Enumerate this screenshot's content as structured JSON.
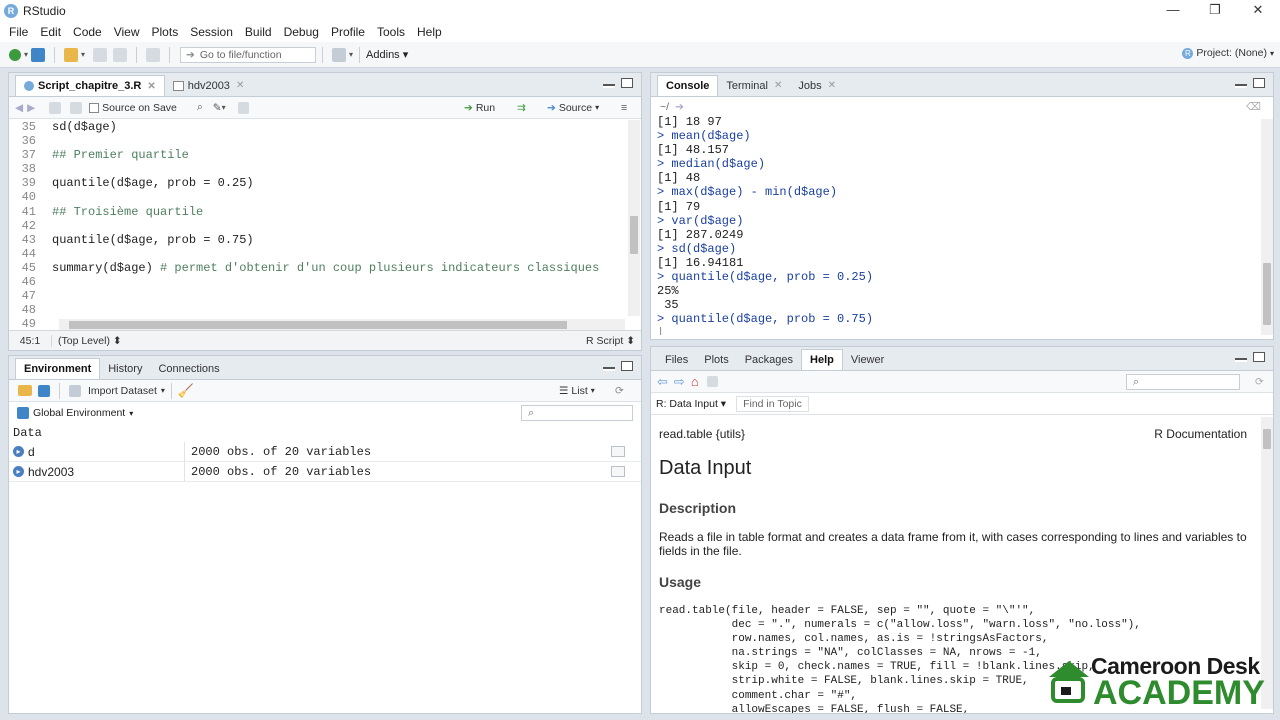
{
  "app": {
    "title": "RStudio",
    "logo_letter": "R"
  },
  "window_controls": {
    "minimize": "—",
    "maximize": "❐",
    "close": "✕"
  },
  "menu": [
    "File",
    "Edit",
    "Code",
    "View",
    "Plots",
    "Session",
    "Build",
    "Debug",
    "Profile",
    "Tools",
    "Help"
  ],
  "toolbar": {
    "goto_placeholder": "Go to file/function",
    "addins": "Addins",
    "project": "Project: (None)"
  },
  "editor": {
    "tabs": [
      {
        "label": "Script_chapitre_3.R",
        "active": true
      },
      {
        "label": "hdv2003",
        "active": false
      }
    ],
    "source_on_save": "Source on Save",
    "run": "Run",
    "source": "Source",
    "lines": [
      {
        "n": "35",
        "code": "sd(d$age)",
        "comment": ""
      },
      {
        "n": "36",
        "code": "",
        "comment": ""
      },
      {
        "n": "37",
        "code": "",
        "comment": "## Premier quartile"
      },
      {
        "n": "38",
        "code": "",
        "comment": ""
      },
      {
        "n": "39",
        "code": "quantile(d$age, prob = 0.25)",
        "comment": ""
      },
      {
        "n": "40",
        "code": "",
        "comment": ""
      },
      {
        "n": "41",
        "code": "",
        "comment": "## Troisième quartile"
      },
      {
        "n": "42",
        "code": "",
        "comment": ""
      },
      {
        "n": "43",
        "code": "quantile(d$age, prob = 0.75)",
        "comment": ""
      },
      {
        "n": "44",
        "code": "",
        "comment": ""
      },
      {
        "n": "45",
        "code": "summary(d$age) ",
        "comment": "# permet d'obtenir d'un coup plusieurs indicateurs classiques"
      },
      {
        "n": "46",
        "code": "",
        "comment": ""
      },
      {
        "n": "47",
        "code": "",
        "comment": ""
      },
      {
        "n": "48",
        "code": "",
        "comment": ""
      },
      {
        "n": "49",
        "code": "",
        "comment": ""
      }
    ],
    "status_pos": "45:1",
    "status_scope": "(Top Level)",
    "status_type": "R Script"
  },
  "console": {
    "tabs": [
      {
        "label": "Console",
        "active": true
      },
      {
        "label": "Terminal",
        "active": false
      },
      {
        "label": "Jobs",
        "active": false
      }
    ],
    "path": "~/",
    "lines": [
      {
        "kind": "out",
        "text": "[1] 18 97"
      },
      {
        "kind": "prompt",
        "text": "> mean(d$age)"
      },
      {
        "kind": "out",
        "text": "[1] 48.157"
      },
      {
        "kind": "prompt",
        "text": "> median(d$age)"
      },
      {
        "kind": "out",
        "text": "[1] 48"
      },
      {
        "kind": "prompt",
        "text": "> max(d$age) - min(d$age)"
      },
      {
        "kind": "out",
        "text": "[1] 79"
      },
      {
        "kind": "prompt",
        "text": "> var(d$age)"
      },
      {
        "kind": "out",
        "text": "[1] 287.0249"
      },
      {
        "kind": "prompt",
        "text": "> sd(d$age)"
      },
      {
        "kind": "out",
        "text": "[1] 16.94181"
      },
      {
        "kind": "prompt",
        "text": "> quantile(d$age, prob = 0.25)"
      },
      {
        "kind": "out",
        "text": "25% "
      },
      {
        "kind": "out",
        "text": " 35 "
      },
      {
        "kind": "prompt",
        "text": "> quantile(d$age, prob = 0.75)"
      },
      {
        "kind": "cursor",
        "text": "|"
      }
    ]
  },
  "environment": {
    "tabs": [
      {
        "label": "Environment",
        "active": true
      },
      {
        "label": "History",
        "active": false
      },
      {
        "label": "Connections",
        "active": false
      }
    ],
    "import_dataset": "Import Dataset",
    "list_view": "List",
    "scope": "Global Environment",
    "section": "Data",
    "rows": [
      {
        "name": "d",
        "value": "2000 obs. of 20 variables"
      },
      {
        "name": "hdv2003",
        "value": "2000 obs. of 20 variables"
      }
    ]
  },
  "help": {
    "tabs": [
      {
        "label": "Files",
        "active": false
      },
      {
        "label": "Plots",
        "active": false
      },
      {
        "label": "Packages",
        "active": false
      },
      {
        "label": "Help",
        "active": true
      },
      {
        "label": "Viewer",
        "active": false
      }
    ],
    "topic": "R: Data Input",
    "find_placeholder": "Find in Topic",
    "package": "read.table {utils}",
    "doc_label": "R Documentation",
    "title": "Data Input",
    "description_heading": "Description",
    "description": "Reads a file in table format and creates a data frame from it, with cases corresponding to lines and variables to fields in the file.",
    "usage_heading": "Usage",
    "usage_code": "read.table(file, header = FALSE, sep = \"\", quote = \"\\\"'\",\n           dec = \".\", numerals = c(\"allow.loss\", \"warn.loss\", \"no.loss\"),\n           row.names, col.names, as.is = !stringsAsFactors,\n           na.strings = \"NA\", colClasses = NA, nrows = -1,\n           skip = 0, check.names = TRUE, fill = !blank.lines.skip,\n           strip.white = FALSE, blank.lines.skip = TRUE,\n           comment.char = \"#\",\n           allowEscapes = FALSE, flush = FALSE,"
  },
  "watermark": {
    "line1": "Cameroon Desk",
    "line2": "ACADEMY"
  },
  "colors": {
    "accent": "#75aadb",
    "prompt": "#1a3fa0",
    "comment": "#4f7f5f",
    "watermark_green": "#2e8b2e"
  }
}
